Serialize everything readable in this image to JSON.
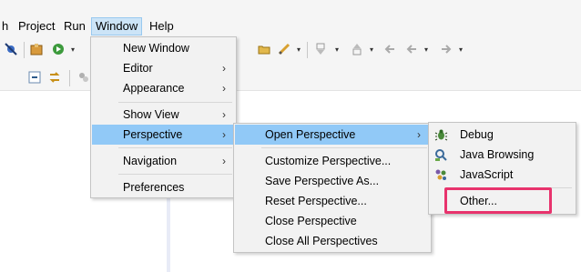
{
  "menubar": {
    "items": [
      {
        "label": "h"
      },
      {
        "label": "Project"
      },
      {
        "label": "Run"
      },
      {
        "label": "Window"
      },
      {
        "label": "Help"
      }
    ]
  },
  "window_menu": {
    "items": [
      {
        "label": "New Window"
      },
      {
        "label": "Editor",
        "has_submenu": true
      },
      {
        "label": "Appearance",
        "has_submenu": true
      },
      {
        "label": "Show View",
        "has_submenu": true
      },
      {
        "label": "Perspective",
        "has_submenu": true,
        "highlighted": true
      },
      {
        "label": "Navigation",
        "has_submenu": true
      },
      {
        "label": "Preferences"
      }
    ]
  },
  "perspective_menu": {
    "items": [
      {
        "label": "Open Perspective",
        "has_submenu": true,
        "highlighted": true
      },
      {
        "label": "Customize Perspective..."
      },
      {
        "label": "Save Perspective As..."
      },
      {
        "label": "Reset Perspective..."
      },
      {
        "label": "Close Perspective"
      },
      {
        "label": "Close All Perspectives"
      }
    ]
  },
  "open_perspective_menu": {
    "items": [
      {
        "label": "Debug",
        "icon": "bug-icon"
      },
      {
        "label": "Java Browsing",
        "icon": "java-browsing-icon"
      },
      {
        "label": "JavaScript",
        "icon": "javascript-icon"
      },
      {
        "label": "Other..."
      }
    ]
  },
  "submenu_arrow": "›",
  "dropdown_arrow": "▾",
  "colors": {
    "highlight": "#91c9f7",
    "menubar_active": "#cce4f7",
    "callout": "#e8336d"
  }
}
